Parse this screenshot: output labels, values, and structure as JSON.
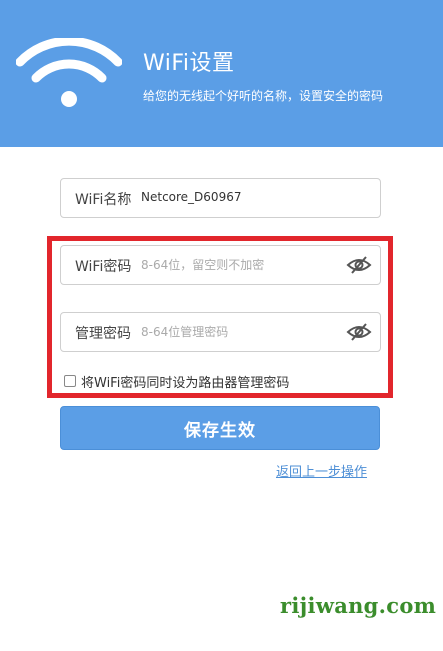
{
  "header": {
    "title": "WiFi设置",
    "subtitle": "给您的无线起个好听的名称，设置安全的密码",
    "logo_icon": "wifi-icon"
  },
  "form": {
    "wifi_name": {
      "label": "WiFi名称",
      "value": "Netcore_D60967"
    },
    "wifi_password": {
      "label": "WiFi密码",
      "placeholder": "8-64位，留空则不加密",
      "icon": "eye-hidden-icon"
    },
    "admin_password": {
      "label": "管理密码",
      "placeholder": "8-64位管理密码",
      "icon": "eye-hidden-icon"
    },
    "same_password_checkbox": {
      "label": "将WiFi密码同时设为路由器管理密码",
      "checked": false
    },
    "save_label": "保存生效",
    "back_label": "返回上一步操作"
  },
  "watermark": "rijiwang.com",
  "colors": {
    "header_bg": "#5b9ee6",
    "button_bg": "#5b9ee6",
    "highlight": "#e2262c",
    "link": "#4e8fd6",
    "watermark": "#3b8d2c"
  }
}
